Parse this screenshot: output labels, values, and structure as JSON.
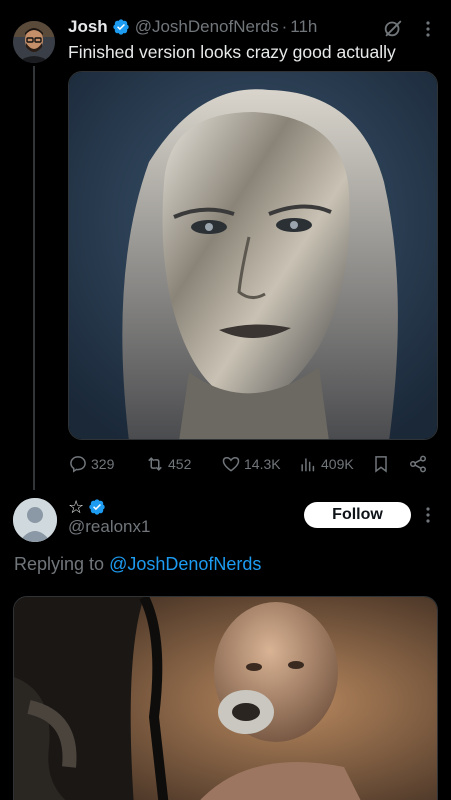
{
  "colors": {
    "background": "#000000",
    "text": "#e7e9ea",
    "muted": "#71767b",
    "accent": "#1d9bf0",
    "divider": "#2f3336"
  },
  "tweet1": {
    "author": {
      "name": "Josh",
      "handle": "@JoshDenofNerds",
      "separator": "·",
      "time": "11h",
      "verified": true,
      "avatar": "avatar-photo"
    },
    "text": "Finished version looks crazy good actually",
    "media": "image-silver-metallic-face",
    "actions": {
      "replies": "329",
      "reposts": "452",
      "likes": "14.3K",
      "views": "409K"
    }
  },
  "tweet2": {
    "author": {
      "name": "☆",
      "handle": "@realonx1",
      "verified": true,
      "avatar": "default-avatar"
    },
    "follow_label": "Follow",
    "replying_prefix": "Replying to",
    "replying_mention": "@JoshDenofNerds",
    "media": "image-bald-figure-chrome-mouth"
  }
}
